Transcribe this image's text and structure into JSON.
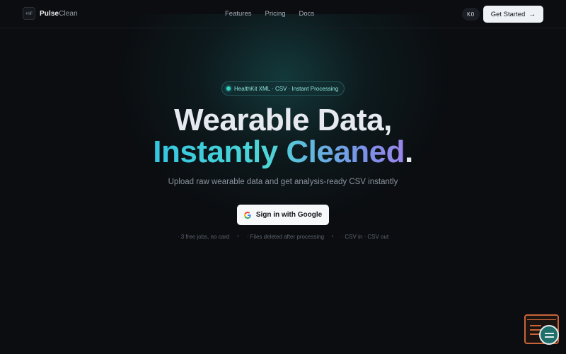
{
  "brand": {
    "mark": "+HF",
    "name_bold": "Pulse",
    "name_light": "Clean"
  },
  "nav": {
    "links": [
      "Features",
      "Pricing",
      "Docs"
    ],
    "lang": "KO",
    "cta": "Get Started"
  },
  "hero": {
    "badge": "HealthKit XML · CSV · Instant Processing",
    "title_line1": "Wearable Data,",
    "title_line2": "Instantly Cleaned",
    "title_period": ".",
    "subtitle": "Upload raw wearable data and get analysis-ready CSV instantly",
    "google_button": "Sign in with Google",
    "footnotes": [
      "· 3 free jobs, no card",
      "· Files deleted after processing",
      "· CSV in · CSV out"
    ],
    "separator": "•"
  },
  "colors": {
    "accent": "#35c6e0",
    "accent2": "#9b86ea",
    "background": "#0b0d10",
    "widget": "#c9643a"
  },
  "icons": {
    "arrow": "arrow-right-icon",
    "google": "google-icon",
    "status": "status-dot-icon",
    "widget": "chat-widget-icon"
  }
}
